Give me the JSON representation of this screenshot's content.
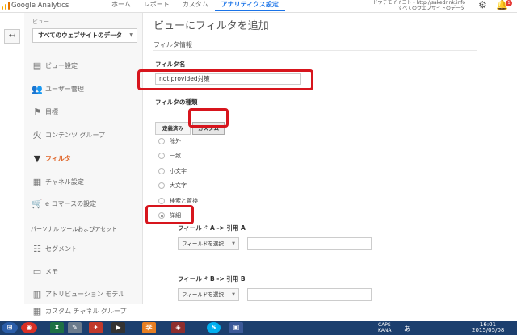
{
  "header": {
    "brand": "Google Analytics",
    "nav": [
      "ホーム",
      "レポート",
      "カスタム",
      "アナリティクス設定"
    ],
    "active_nav": 3,
    "account_line1": "ドウテモイイコト - http://sakedrink.info",
    "account_line2": "すべてのウェブサイトのデータ"
  },
  "sidebar": {
    "view_label": "ビュー",
    "view_value": "すべてのウェブサイトのデータ",
    "items": [
      {
        "label": "ビュー設定",
        "icon": "document-icon"
      },
      {
        "label": "ユーザー管理",
        "icon": "users-icon"
      },
      {
        "label": "目標",
        "icon": "flag-icon"
      },
      {
        "label": "コンテンツ グループ",
        "icon": "person-walk-icon"
      },
      {
        "label": "フィルタ",
        "icon": "filter-icon"
      },
      {
        "label": "チャネル設定",
        "icon": "channel-icon"
      },
      {
        "label": "e コマースの設定",
        "icon": "cart-icon"
      }
    ],
    "active_index": 4,
    "section_header": "パーソナル ツールおよびアセット",
    "tools": [
      {
        "label": "セグメント",
        "icon": "segment-icon"
      },
      {
        "label": "メモ",
        "icon": "memo-icon"
      },
      {
        "label": "アトリビューション モデル",
        "icon": "bar-chart-icon"
      },
      {
        "label": "カスタム チャネル グループ",
        "icon": "channel-icon"
      }
    ]
  },
  "main": {
    "page_title": "ビューにフィルタを追加",
    "section_title": "フィルタ情報",
    "filter_name_label": "フィルタ名",
    "filter_name_value": "not provided対策",
    "filter_type_label": "フィルタの種類",
    "type_buttons": [
      "定義済み",
      "カスタム"
    ],
    "selected_type": 1,
    "radio_options": [
      "除外",
      "一致",
      "小文字",
      "大文字",
      "検索と置換",
      "詳細"
    ],
    "selected_radio": 5,
    "field_a_label": "フィールド A -> 引用 A",
    "field_b_label": "フィールド B -> 引用 B",
    "field_select_placeholder": "フィールドを選択",
    "highlight_color": "#d7151d"
  },
  "taskbar": {
    "clock_time": "16:01",
    "clock_date": "2015/05/08",
    "caps": "CAPS",
    "kana": "KANA",
    "ime": "あ"
  }
}
